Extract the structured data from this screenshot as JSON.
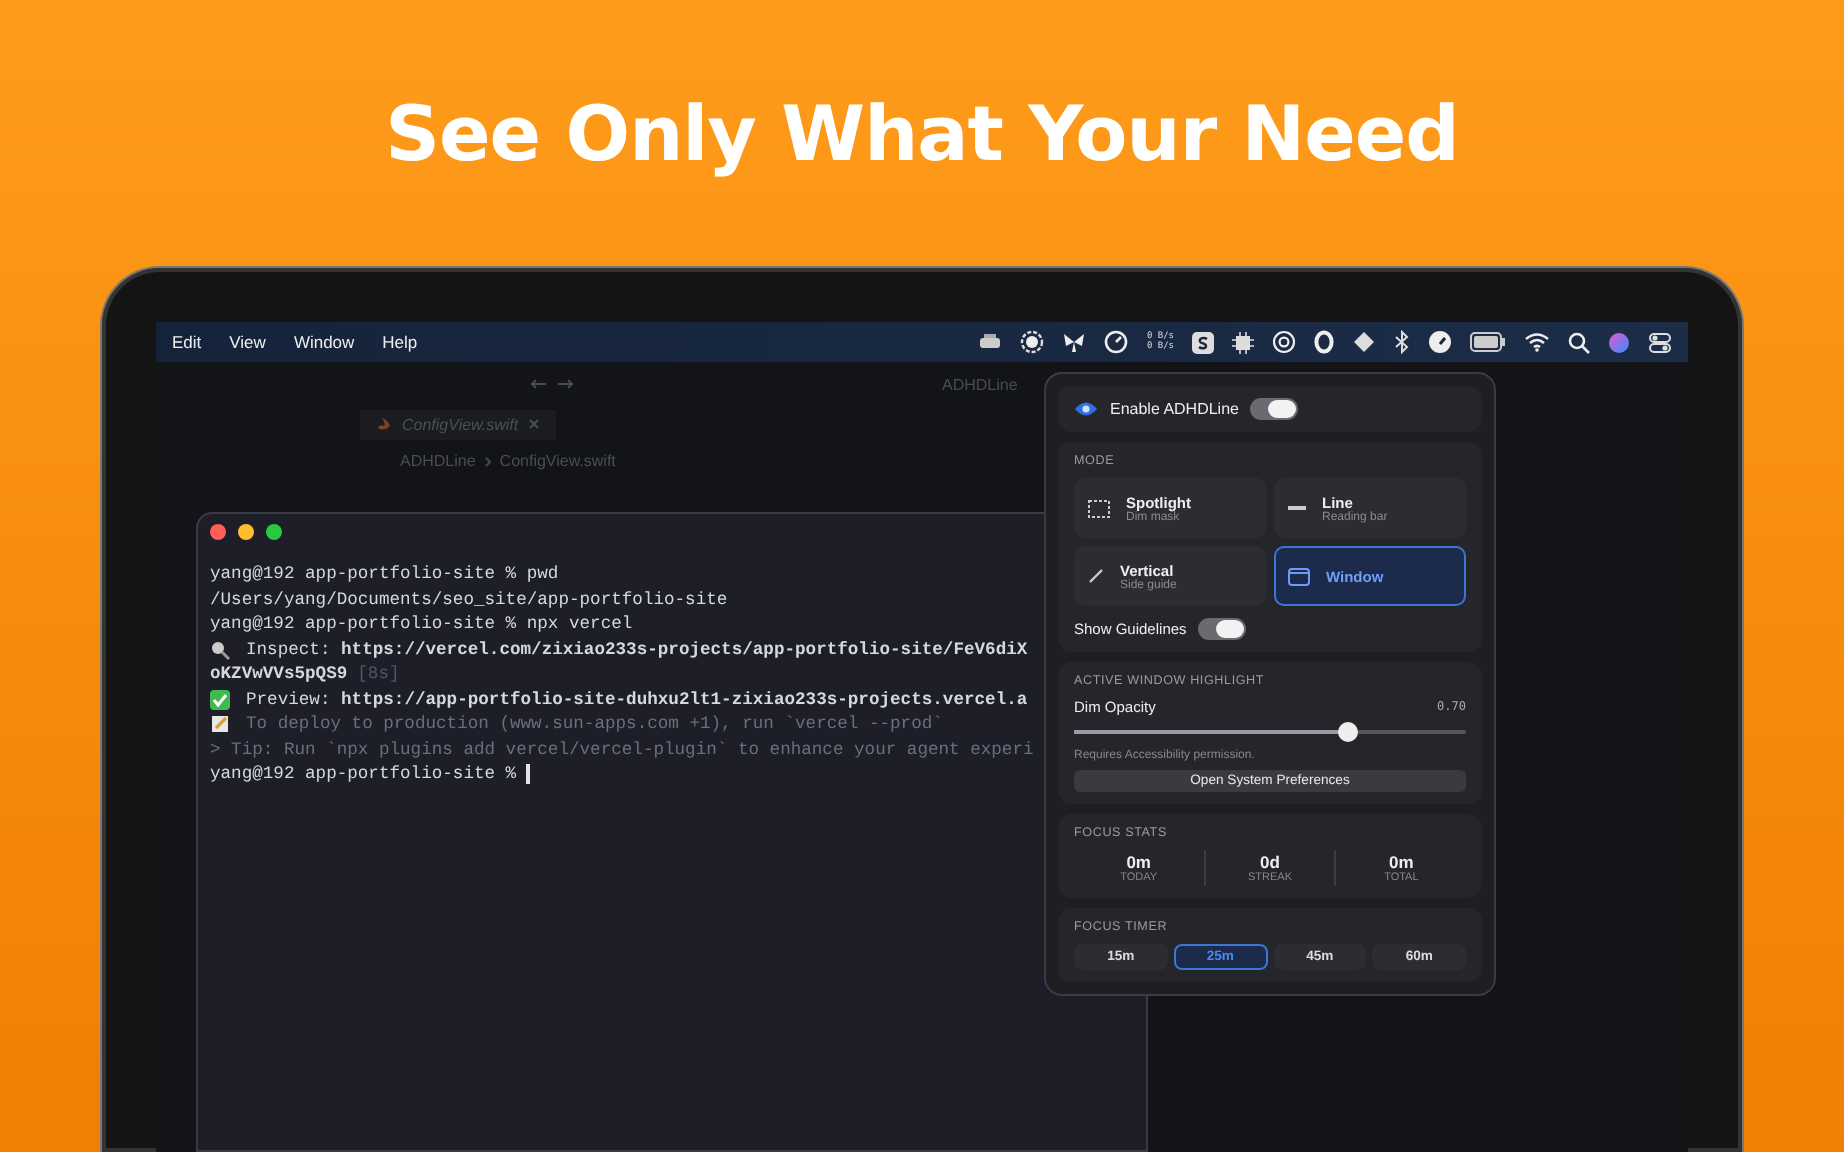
{
  "headline": "See Only What Your Need",
  "menu_bar": {
    "menus": [
      "Edit",
      "View",
      "Window",
      "Help"
    ],
    "net_speed": [
      "0 B/s",
      "0 B/s"
    ]
  },
  "editor": {
    "project": "ADHDLine",
    "tab": "ConfigView.swift",
    "breadcrumb": [
      "ADHDLine",
      "ConfigView.swift"
    ]
  },
  "terminal": {
    "lines": [
      {
        "kind": "plain",
        "text": "yang@192 app-portfolio-site % pwd"
      },
      {
        "kind": "plain",
        "text": "/Users/yang/Documents/seo_site/app-portfolio-site"
      },
      {
        "kind": "plain",
        "text": "yang@192 app-portfolio-site % npx vercel"
      },
      {
        "kind": "inspect",
        "text": "Inspect: **https://vercel.com/zixiao233s-projects/app-portfolio-site/FeV6diX**"
      },
      {
        "kind": "continued",
        "text": "**oKZVwVVs5pQS9**",
        "note": "[8s]"
      },
      {
        "kind": "preview",
        "text": "Preview: **https://app-portfolio-site-duhxu2lt1-zixiao233s-projects.vercel.a**"
      },
      {
        "kind": "deploy",
        "text": "To deploy to production (www.sun-apps.com +1), run `vercel --prod`"
      },
      {
        "kind": "tip",
        "text": "> Tip: Run `npx plugins add vercel/vercel-plugin` to enhance your agent experi"
      },
      {
        "kind": "cursor",
        "text": "yang@192 app-portfolio-site %"
      }
    ]
  },
  "popup": {
    "enable": {
      "label": "Enable ADHDLine",
      "on": true
    },
    "mode": {
      "title": "MODE",
      "options": [
        {
          "kind": "spotlight",
          "title": "Spotlight",
          "subtitle": "Dim mask",
          "selected": false
        },
        {
          "kind": "line",
          "title": "Line",
          "subtitle": "Reading bar",
          "selected": false
        },
        {
          "kind": "vertical",
          "title": "Vertical",
          "subtitle": "Side guide",
          "selected": false
        },
        {
          "kind": "window",
          "title": "Window",
          "selected": true
        }
      ],
      "guidelines": {
        "label": "Show Guidelines",
        "on": true
      }
    },
    "highlight": {
      "title": "ACTIVE WINDOW HIGHLIGHT",
      "slider": {
        "label": "Dim Opacity",
        "reading": "0.70",
        "level": 0.7
      },
      "note": "Requires Accessibility permission.",
      "button": "Open System Preferences"
    },
    "stats": {
      "title": "FOCUS STATS",
      "items": [
        {
          "value": "0m",
          "label": "TODAY"
        },
        {
          "value": "0d",
          "label": "STREAK"
        },
        {
          "value": "0m",
          "label": "TOTAL"
        }
      ]
    },
    "timer": {
      "title": "FOCUS TIMER",
      "options": [
        {
          "label": "15m",
          "selected": false
        },
        {
          "label": "25m",
          "selected": true
        },
        {
          "label": "45m",
          "selected": false
        },
        {
          "label": "60m",
          "selected": false
        }
      ]
    }
  }
}
